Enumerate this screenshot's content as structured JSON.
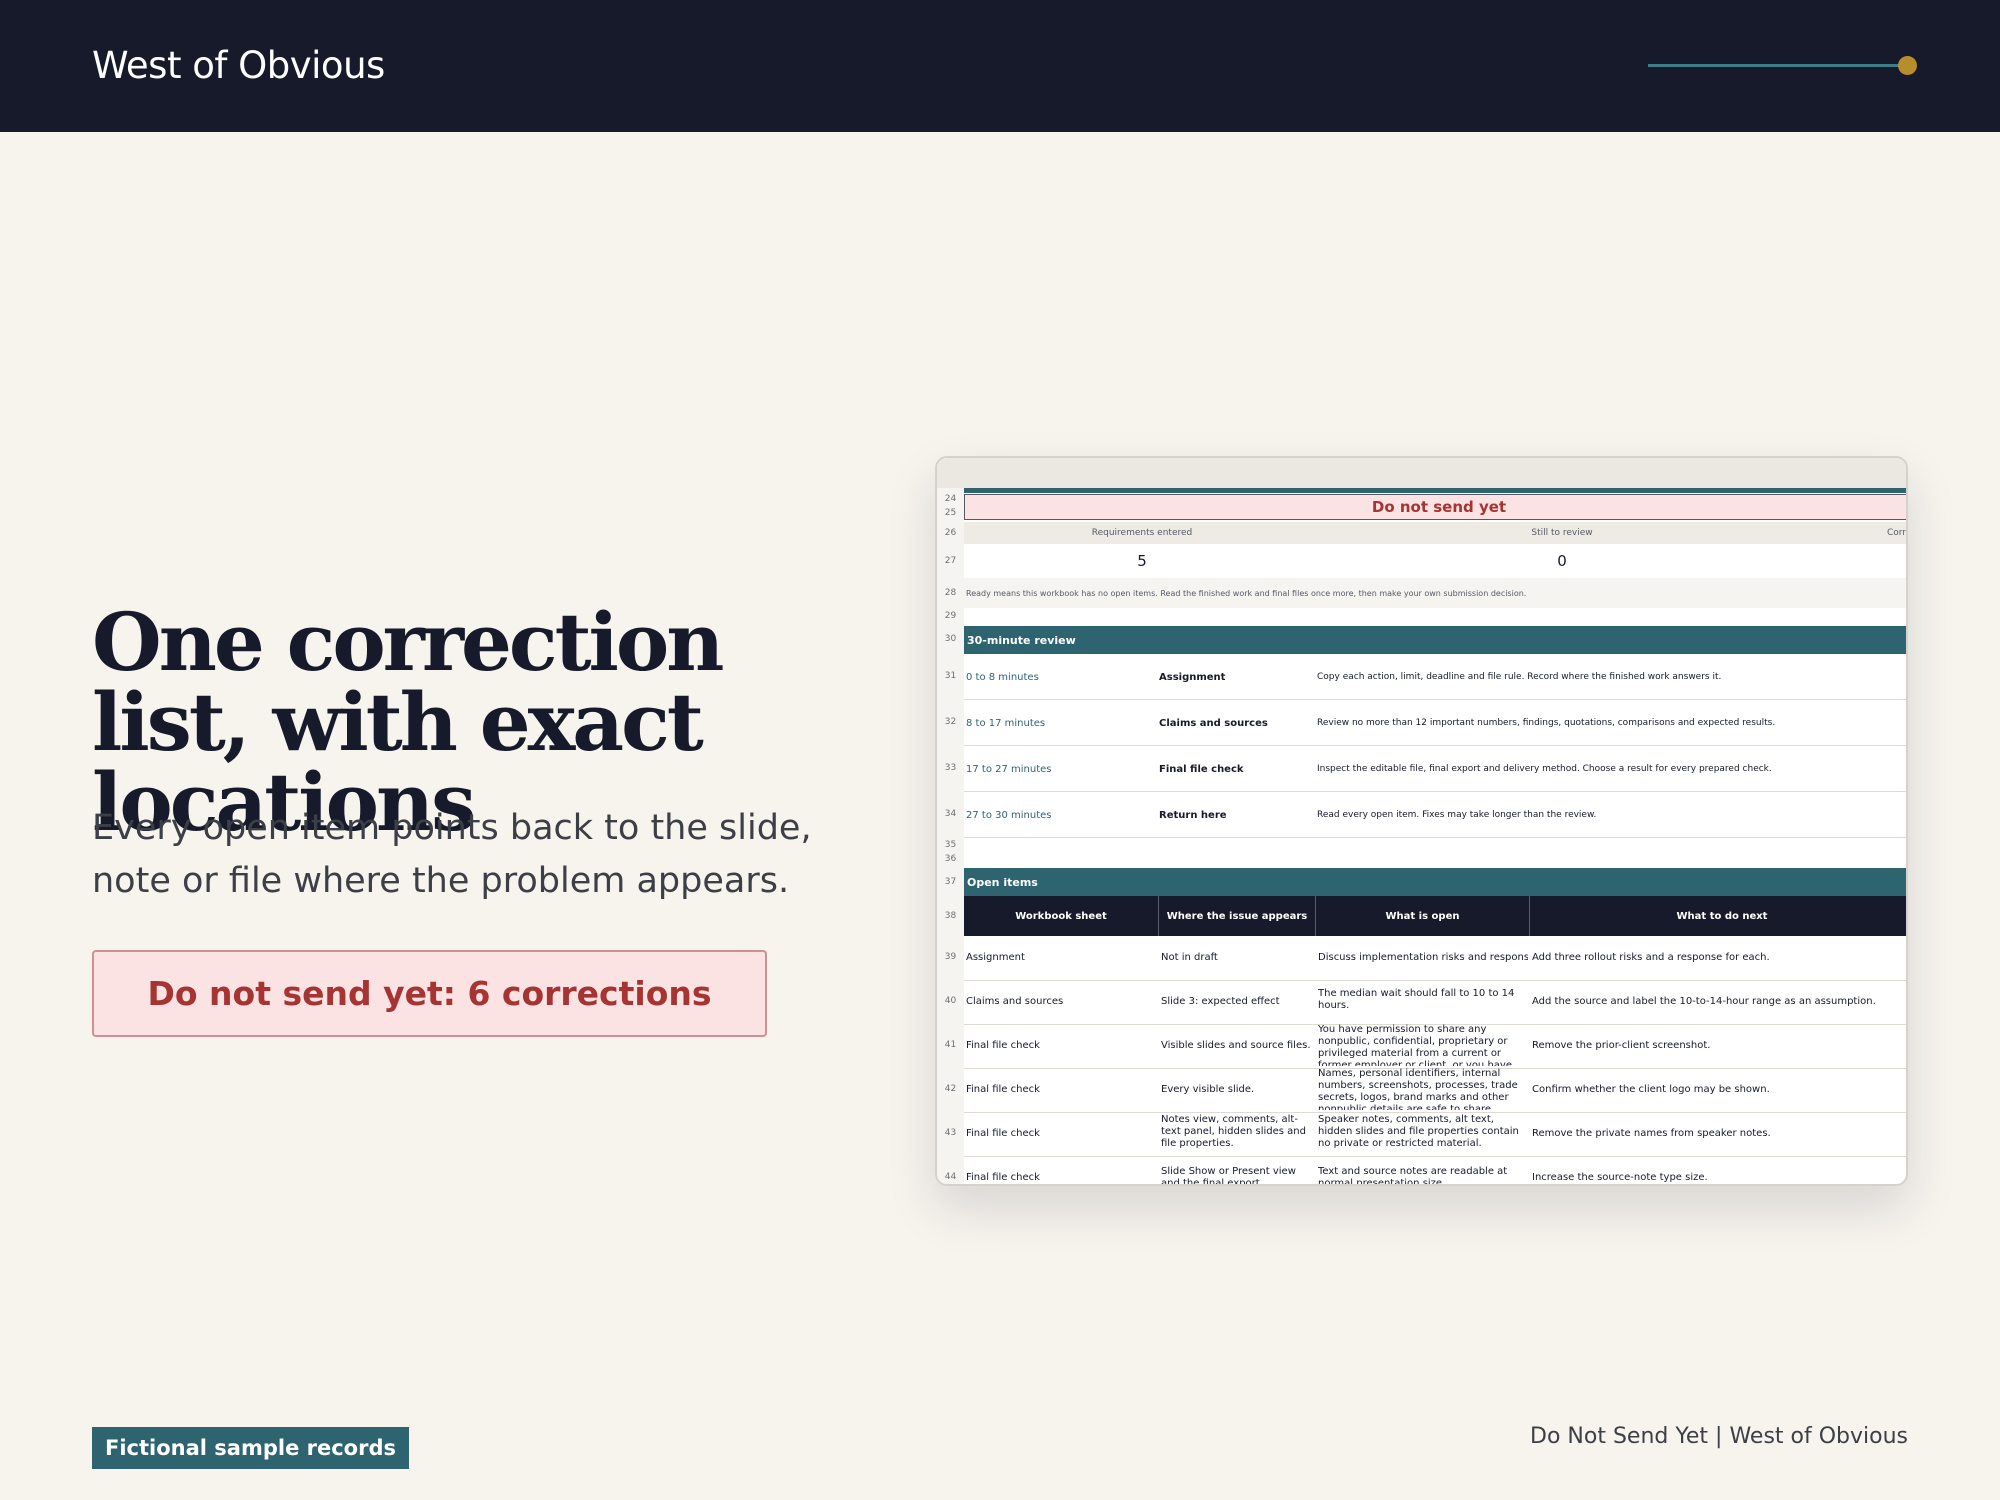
{
  "header": {
    "brand": "West of Obvious"
  },
  "hero": {
    "headline": "One correction list, with exact locations",
    "subtext": "Every open item points back to the slide, note or file where the problem appears.",
    "status": "Do not send yet: 6 corrections"
  },
  "footer": {
    "tag": "Fictional sample records",
    "right": "Do Not Send Yet | West of Obvious"
  },
  "sheet": {
    "row_numbers": [
      "24",
      "25",
      "26",
      "27",
      "28",
      "29",
      "30",
      "31",
      "32",
      "33",
      "34",
      "35",
      "36",
      "37",
      "38",
      "39",
      "40",
      "41",
      "42",
      "43",
      "44"
    ],
    "banner": "Do not send yet",
    "stat_labels": [
      "Requirements entered",
      "Still to review",
      "Corr"
    ],
    "stat_values": [
      "5",
      "0"
    ],
    "ready_note": "Ready means this workbook has no open items. Read the finished work and final files once more, then make your own submission decision.",
    "review": {
      "title": "30-minute review",
      "rows": [
        {
          "time": "0 to 8 minutes",
          "task": "Assignment",
          "detail": "Copy each action, limit, deadline and file rule. Record where the finished work answers it."
        },
        {
          "time": "8 to 17 minutes",
          "task": "Claims and sources",
          "detail": "Review no more than 12 important numbers, findings, quotations, comparisons and expected results."
        },
        {
          "time": "17 to 27 minutes",
          "task": "Final file check",
          "detail": "Inspect the editable file, final export and delivery method. Choose a result for every prepared check."
        },
        {
          "time": "27 to 30 minutes",
          "task": "Return here",
          "detail": "Read every open item. Fixes may take longer than the review."
        }
      ]
    },
    "open_items": {
      "title": "Open items",
      "headers": [
        "Workbook sheet",
        "Where the issue appears",
        "What is open",
        "What to do next"
      ],
      "rows": [
        {
          "sheet": "Assignment",
          "where": "Not in draft",
          "open": "Discuss implementation risks and responses",
          "next": "Add three rollout risks and a response for each."
        },
        {
          "sheet": "Claims and sources",
          "where": "Slide 3: expected effect",
          "open": "The median wait should fall to 10 to 14 hours.",
          "next": "Add the source and label the 10-to-14-hour range as an assumption."
        },
        {
          "sheet": "Final file check",
          "where": "Visible slides and source files.",
          "open": "You have permission to share any nonpublic, confidential, proprietary or privileged material from a current or former employer or client, or you have removed it.",
          "next": "Remove the prior-client screenshot."
        },
        {
          "sheet": "Final file check",
          "where": "Every visible slide.",
          "open": "Names, personal identifiers, internal numbers, screenshots, processes, trade secrets, logos, brand marks and other nonpublic details are safe to share.",
          "next": "Confirm whether the client logo may be shown."
        },
        {
          "sheet": "Final file check",
          "where": "Notes view, comments, alt-text panel, hidden slides and file properties.",
          "open": "Speaker notes, comments, alt text, hidden slides and file properties contain no private or restricted material.",
          "next": "Remove the private names from speaker notes."
        },
        {
          "sheet": "Final file check",
          "where": "Slide Show or Present view and the final export.",
          "open": "Text and source notes are readable at normal presentation size.",
          "next": "Increase the source-note type size."
        }
      ]
    }
  },
  "colors": {
    "navy": "#161a2b",
    "teal": "#2d6470",
    "gold": "#b98d2b",
    "alert": "#a53432",
    "alert_bg": "#fbe2e3",
    "page_bg": "#f7f4ee"
  }
}
